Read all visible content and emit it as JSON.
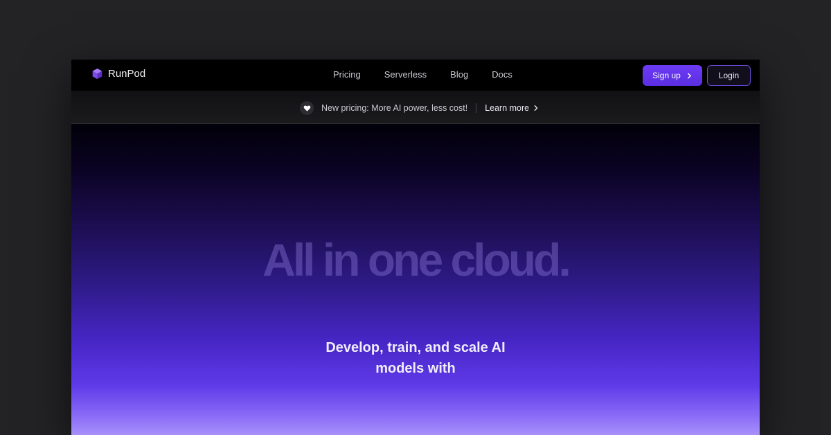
{
  "brand": {
    "name": "RunPod",
    "icon": "cube-icon"
  },
  "nav": {
    "links": [
      "Pricing",
      "Serverless",
      "Blog",
      "Docs"
    ]
  },
  "auth": {
    "signup_label": "Sign up",
    "login_label": "Login"
  },
  "announcement": {
    "icon": "heart-icon",
    "text": "New pricing: More AI power, less cost!",
    "link_label": "Learn more"
  },
  "hero": {
    "title": "All in one cloud.",
    "subtitle_line1": "Develop, train, and scale AI",
    "subtitle_line2": "models with"
  },
  "colors": {
    "accent": "#6d3bf5",
    "background": "#232326",
    "hero_bottom": "#a890fb"
  }
}
